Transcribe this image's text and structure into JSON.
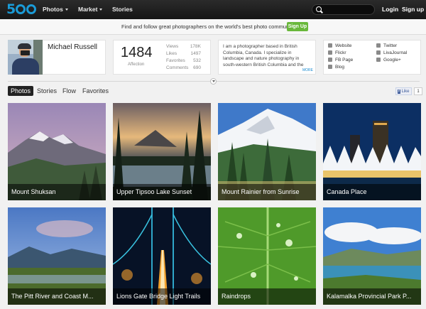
{
  "header": {
    "logo": "5",
    "nav": [
      {
        "label": "Photos",
        "dropdown": true
      },
      {
        "label": "Market",
        "dropdown": true
      },
      {
        "label": "Stories",
        "dropdown": false
      }
    ],
    "search_placeholder": "",
    "login": "Login",
    "signup": "Sign up"
  },
  "banner": {
    "text": "Find and follow great photographers on the world's best photo community.",
    "button": "Sign Up"
  },
  "profile": {
    "name": "Michael Russell",
    "affection_value": "1484",
    "affection_label": "Affection",
    "stats": [
      {
        "label": "Views",
        "value": "178K"
      },
      {
        "label": "Likes",
        "value": "1497"
      },
      {
        "label": "Favorites",
        "value": "532"
      },
      {
        "label": "Comments",
        "value": "690"
      }
    ],
    "bio": "I am a photographer based in British Columbia, Canada. I specialize in landscape and nature photography in south-western British Columbia and the",
    "more": "MORE",
    "links_left": [
      "Website",
      "Flickr",
      "FB Page",
      "Blog"
    ],
    "links_right": [
      "Twitter",
      "LivaJournal",
      "Google+"
    ]
  },
  "tabs": [
    "Photos",
    "Stories",
    "Flow",
    "Favorites"
  ],
  "like": {
    "label": "Like",
    "count": "1"
  },
  "photos": [
    {
      "title": "Mount Shuksan"
    },
    {
      "title": "Upper Tipsoo Lake Sunset"
    },
    {
      "title": "Mount Rainier from Sunrise"
    },
    {
      "title": "Canada Place"
    },
    {
      "title": "The Pitt River and Coast M..."
    },
    {
      "title": "Lions Gate Bridge Light Trails"
    },
    {
      "title": "Raindrops"
    },
    {
      "title": "Kalamalka Provincial Park P..."
    }
  ],
  "colors": {
    "brand": "#1a9bd7",
    "signup": "#69b83b"
  }
}
